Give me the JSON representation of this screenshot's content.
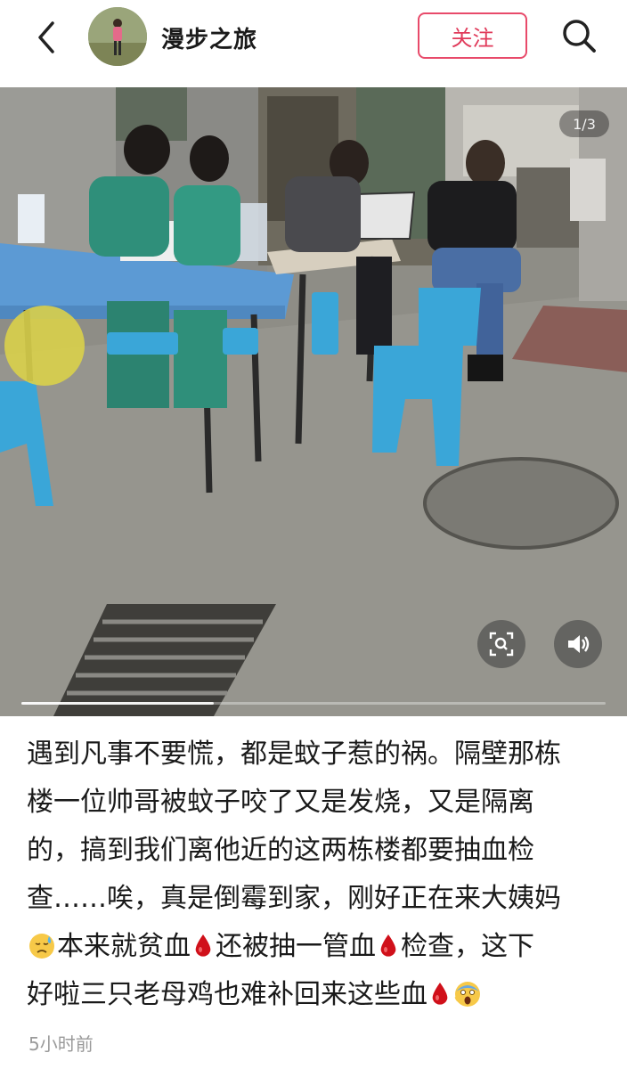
{
  "header": {
    "back_icon": "chevron-left-icon",
    "author_name": "漫步之旅",
    "follow_label": "关注",
    "search_icon": "search-icon"
  },
  "media": {
    "counter_text": "1/3",
    "progress_fraction": 0.33,
    "buttons": [
      "lens-search-icon",
      "speaker-icon"
    ]
  },
  "post": {
    "segments": [
      "遇到凡事不要慌，都是蚊子惹的祸。隔壁那栋",
      "楼一位帅哥被蚊子咬了又是发烧，又是隔离",
      "的，搞到我们离他近的这两栋楼都要抽血检",
      "查……唉，真是倒霉到家，刚好正在来大姨妈",
      "本来就贫血",
      "还被抽一管血",
      "检查，这下",
      "好啦三只老母鸡也难补回来这些血"
    ],
    "emojis": [
      "sad-sweat-face-emoji",
      "drop-of-blood-emoji",
      "drop-of-blood-emoji",
      "drop-of-blood-emoji",
      "screaming-face-emoji"
    ],
    "time_ago": "5小时前"
  },
  "colors": {
    "follow_accent": "#e84a6a",
    "blood_red": "#d0101a",
    "stool_blue": "#3aa6d8",
    "scrub_green": "#2f8f7a"
  }
}
